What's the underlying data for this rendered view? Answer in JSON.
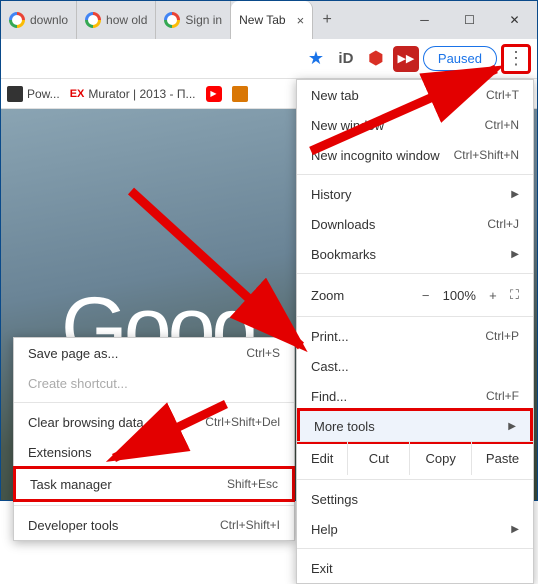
{
  "tabs": [
    {
      "label": "downlo"
    },
    {
      "label": "how old"
    },
    {
      "label": "Sign in"
    },
    {
      "label": "New Tab",
      "active": true
    }
  ],
  "toolbar": {
    "paused_label": "Paused"
  },
  "bookmarks": [
    {
      "label": "Pow..."
    },
    {
      "label": "Murator | 2013 - П..."
    }
  ],
  "logo": "Goog",
  "menu": {
    "new_tab": {
      "label": "New tab",
      "shortcut": "Ctrl+T"
    },
    "new_window": {
      "label": "New window",
      "shortcut": "Ctrl+N"
    },
    "new_incognito": {
      "label": "New incognito window",
      "shortcut": "Ctrl+Shift+N"
    },
    "history": {
      "label": "History"
    },
    "downloads": {
      "label": "Downloads",
      "shortcut": "Ctrl+J"
    },
    "bookmarks": {
      "label": "Bookmarks"
    },
    "zoom": {
      "label": "Zoom",
      "value": "100%"
    },
    "print": {
      "label": "Print...",
      "shortcut": "Ctrl+P"
    },
    "cast": {
      "label": "Cast..."
    },
    "find": {
      "label": "Find...",
      "shortcut": "Ctrl+F"
    },
    "more_tools": {
      "label": "More tools"
    },
    "edit": {
      "label": "Edit",
      "cut": "Cut",
      "copy": "Copy",
      "paste": "Paste"
    },
    "settings": {
      "label": "Settings"
    },
    "help": {
      "label": "Help"
    },
    "exit": {
      "label": "Exit"
    }
  },
  "submenu": {
    "save_page": {
      "label": "Save page as...",
      "shortcut": "Ctrl+S"
    },
    "create_shortcut": {
      "label": "Create shortcut..."
    },
    "clear_data": {
      "label": "Clear browsing data...",
      "shortcut": "Ctrl+Shift+Del"
    },
    "extensions": {
      "label": "Extensions"
    },
    "task_manager": {
      "label": "Task manager",
      "shortcut": "Shift+Esc"
    },
    "dev_tools": {
      "label": "Developer tools",
      "shortcut": "Ctrl+Shift+I"
    }
  }
}
